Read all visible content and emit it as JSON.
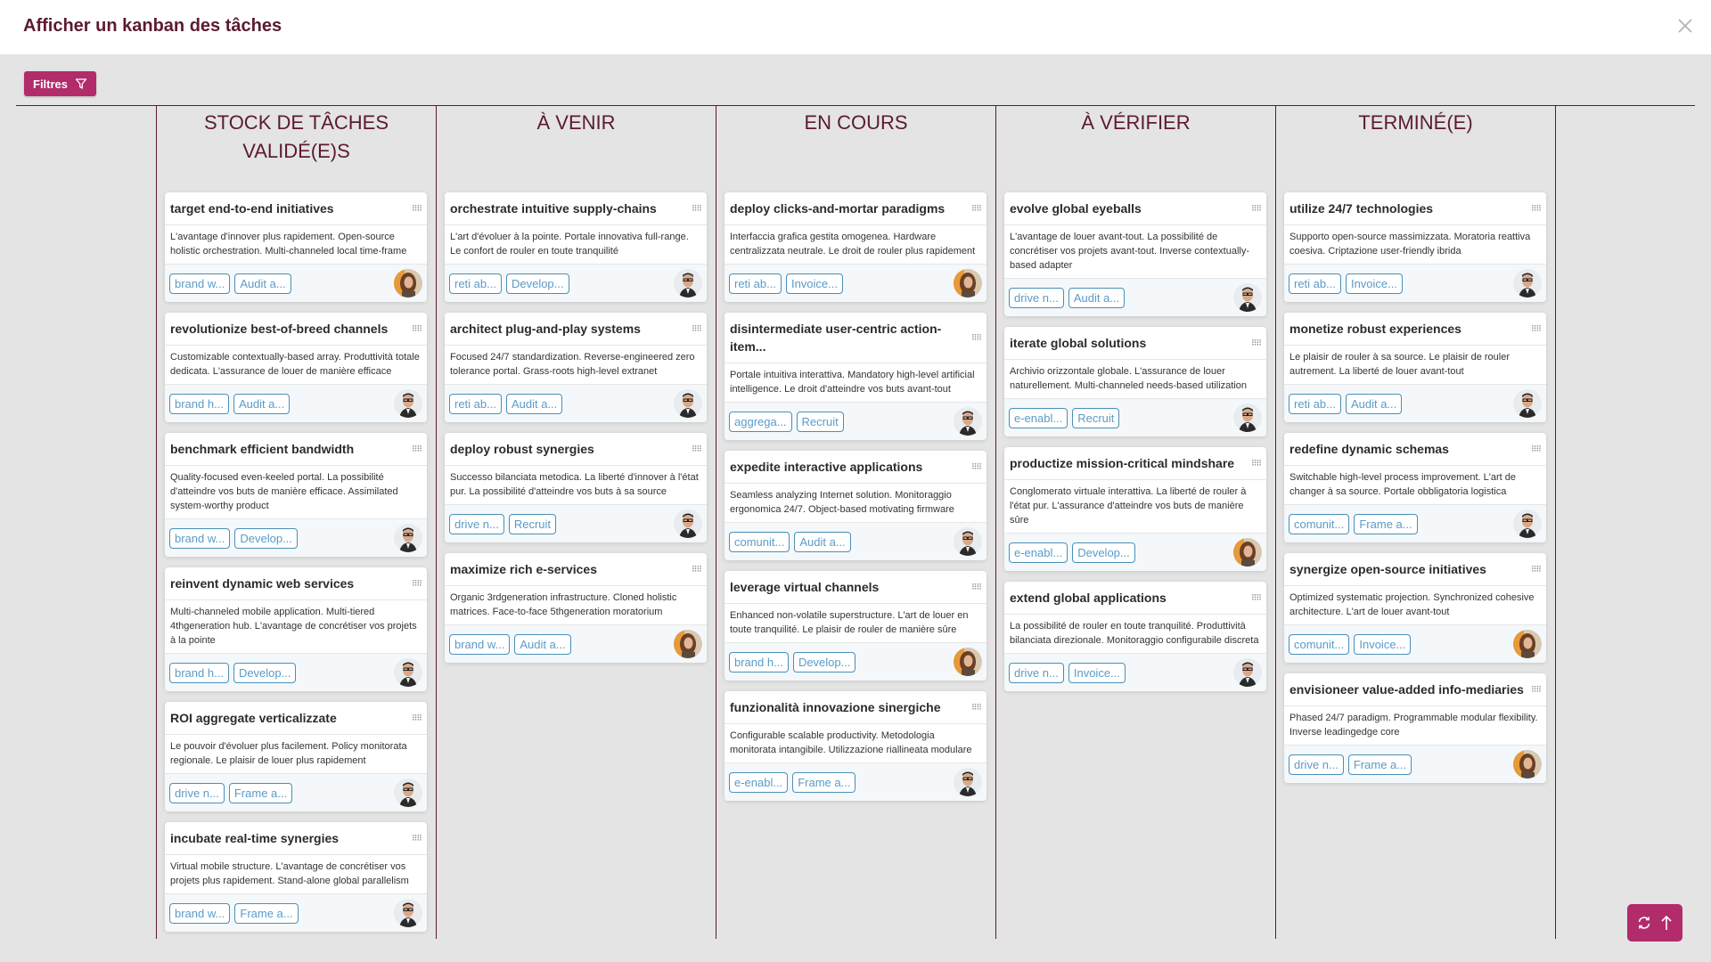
{
  "header": {
    "title": "Afficher un kanban des tâches",
    "close_icon": "close-icon"
  },
  "toolbar": {
    "filters_label": "Filtres",
    "filter_icon": "filter-icon"
  },
  "colors": {
    "accent": "#b22b6a",
    "title": "#5c1a33",
    "tag": "#5b9bc7"
  },
  "columns": [
    {
      "title": "STOCK DE TÂCHES VALIDÉ(E)S",
      "cards": [
        {
          "title": "target end-to-end initiatives",
          "desc": "L'avantage d'innover plus rapidement. Open-source holistic orchestration. Multi-channeled local time-frame",
          "tags": [
            "brand w...",
            "Audit a..."
          ],
          "avatar": "woman"
        },
        {
          "title": "revolutionize best-of-breed channels",
          "desc": "Customizable contextually-based array. Produttività totale dedicata. L'assurance de louer de manière efficace",
          "tags": [
            "brand h...",
            "Audit a..."
          ],
          "avatar": "man"
        },
        {
          "title": "benchmark efficient bandwidth",
          "desc": "Quality-focused even-keeled portal. La possibilité d'atteindre vos buts de manière efficace. Assimilated system-worthy product",
          "tags": [
            "brand w...",
            "Develop..."
          ],
          "avatar": "man"
        },
        {
          "title": "reinvent dynamic web services",
          "desc": "Multi-channeled mobile application. Multi-tiered 4thgeneration hub. L'avantage de concrétiser vos projets à la pointe",
          "tags": [
            "brand h...",
            "Develop..."
          ],
          "avatar": "man"
        },
        {
          "title": "ROI aggregate verticalizzate",
          "desc": "Le pouvoir d'évoluer plus facilement. Policy monitorata regionale. Le plaisir de louer plus rapidement",
          "tags": [
            "drive n...",
            "Frame a..."
          ],
          "avatar": "man"
        },
        {
          "title": "incubate real-time synergies",
          "desc": "Virtual mobile structure. L'avantage de concrétiser vos projets plus rapidement. Stand-alone global parallelism",
          "tags": [
            "brand w...",
            "Frame a..."
          ],
          "avatar": "man"
        }
      ]
    },
    {
      "title": "À VENIR",
      "cards": [
        {
          "title": "orchestrate intuitive supply-chains",
          "desc": "L'art d'évoluer à la pointe. Portale innovativa full-range. Le confort de rouler en toute tranquilité",
          "tags": [
            "reti ab...",
            "Develop..."
          ],
          "avatar": "man"
        },
        {
          "title": "architect plug-and-play systems",
          "desc": "Focused 24/7 standardization. Reverse-engineered zero tolerance portal. Grass-roots high-level extranet",
          "tags": [
            "reti ab...",
            "Audit a..."
          ],
          "avatar": "man"
        },
        {
          "title": "deploy robust synergies",
          "desc": "Successo bilanciata metodica. La liberté d'innover à l'état pur. La possibilité d'atteindre vos buts à sa source",
          "tags": [
            "drive n...",
            "Recruit"
          ],
          "avatar": "man"
        },
        {
          "title": "maximize rich e-services",
          "desc": "Organic 3rdgeneration infrastructure. Cloned holistic matrices. Face-to-face 5thgeneration moratorium",
          "tags": [
            "brand w...",
            "Audit a..."
          ],
          "avatar": "woman"
        }
      ]
    },
    {
      "title": "EN COURS",
      "cards": [
        {
          "title": "deploy clicks-and-mortar paradigms",
          "desc": "Interfaccia grafica gestita omogenea. Hardware centralizzata neutrale. Le droit de rouler plus rapidement",
          "tags": [
            "reti ab...",
            "Invoice..."
          ],
          "avatar": "woman"
        },
        {
          "title": "disintermediate user-centric action-item...",
          "desc": "Portale intuitiva interattiva. Mandatory high-level artificial intelligence. Le droit d'atteindre vos buts avant-tout",
          "tags": [
            "aggrega...",
            "Recruit"
          ],
          "avatar": "man"
        },
        {
          "title": "expedite interactive applications",
          "desc": "Seamless analyzing Internet solution. Monitoraggio ergonomica 24/7. Object-based motivating firmware",
          "tags": [
            "comunit...",
            "Audit a..."
          ],
          "avatar": "man"
        },
        {
          "title": "leverage virtual channels",
          "desc": "Enhanced non-volatile superstructure. L'art de louer en toute tranquilité. Le plaisir de rouler de manière sûre",
          "tags": [
            "brand h...",
            "Develop..."
          ],
          "avatar": "woman"
        },
        {
          "title": "funzionalità innovazione sinergiche",
          "desc": "Configurable scalable productivity. Metodologia monitorata intangibile. Utilizzazione riallineata modulare",
          "tags": [
            "e-enabl...",
            "Frame a..."
          ],
          "avatar": "man"
        }
      ]
    },
    {
      "title": "À VÉRIFIER",
      "cards": [
        {
          "title": "evolve global eyeballs",
          "desc": "L'avantage de louer avant-tout. La possibilité de concrétiser vos projets avant-tout. Inverse contextually-based adapter",
          "tags": [
            "drive n...",
            "Audit a..."
          ],
          "avatar": "man"
        },
        {
          "title": "iterate global solutions",
          "desc": "Archivio orizzontale globale. L'assurance de louer naturellement. Multi-channeled needs-based utilization",
          "tags": [
            "e-enabl...",
            "Recruit"
          ],
          "avatar": "man"
        },
        {
          "title": "productize mission-critical mindshare",
          "desc": "Conglomerato virtuale interattiva. La liberté de rouler à l'état pur. L'assurance d'atteindre vos buts de manière sûre",
          "tags": [
            "e-enabl...",
            "Develop..."
          ],
          "avatar": "woman"
        },
        {
          "title": "extend global applications",
          "desc": "La possibilité de rouler en toute tranquilité. Produttività bilanciata direzionale. Monitoraggio configurabile discreta",
          "tags": [
            "drive n...",
            "Invoice..."
          ],
          "avatar": "man"
        }
      ]
    },
    {
      "title": "TERMINÉ(E)",
      "cards": [
        {
          "title": "utilize 24/7 technologies",
          "desc": "Supporto open-source massimizzata. Moratoria reattiva coesiva. Criptazione user-friendly ibrida",
          "tags": [
            "reti ab...",
            "Invoice..."
          ],
          "avatar": "man"
        },
        {
          "title": "monetize robust experiences",
          "desc": "Le plaisir de rouler à sa source. Le plaisir de rouler autrement. La liberté de louer avant-tout",
          "tags": [
            "reti ab...",
            "Audit a..."
          ],
          "avatar": "man"
        },
        {
          "title": "redefine dynamic schemas",
          "desc": "Switchable high-level process improvement. L'art de changer à sa source. Portale obbligatoria logistica",
          "tags": [
            "comunit...",
            "Frame a..."
          ],
          "avatar": "man"
        },
        {
          "title": "synergize open-source initiatives",
          "desc": "Optimized systematic projection. Synchronized cohesive architecture. L'art de louer avant-tout",
          "tags": [
            "comunit...",
            "Invoice..."
          ],
          "avatar": "woman"
        },
        {
          "title": "envisioneer value-added info-mediaries",
          "desc": "Phased 24/7 paradigm. Programmable modular flexibility. Inverse leadingedge core",
          "tags": [
            "drive n...",
            "Frame a..."
          ],
          "avatar": "woman"
        }
      ]
    }
  ],
  "fab": {
    "refresh_icon": "refresh-icon",
    "scroll_top_icon": "arrow-up-icon"
  },
  "handle_glyph": "⠿⠿"
}
